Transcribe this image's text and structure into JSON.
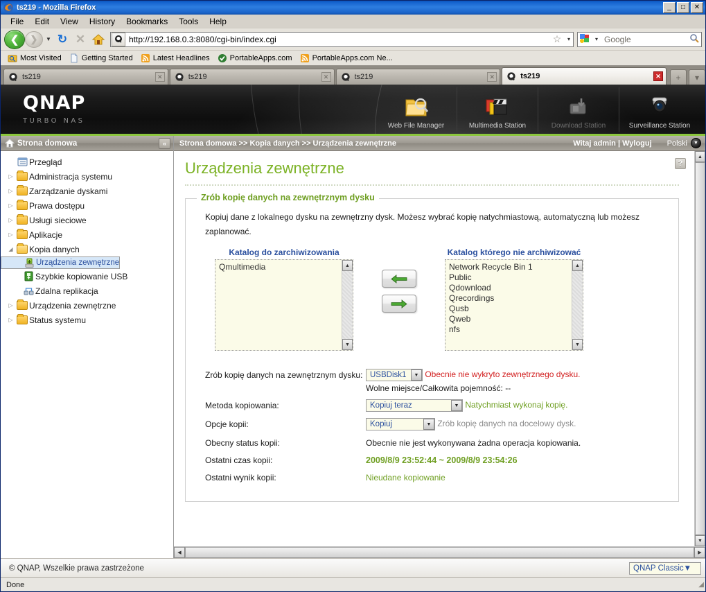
{
  "browser": {
    "title": "ts219 - Mozilla Firefox",
    "window_controls": {
      "minimize": "_",
      "maximize": "□",
      "close": "✕"
    },
    "menu": [
      "File",
      "Edit",
      "View",
      "History",
      "Bookmarks",
      "Tools",
      "Help"
    ],
    "toolbar": {
      "back": "back-button",
      "forward": "forward-button",
      "reload": "↻",
      "stop": "✕",
      "home": "home-button",
      "star": "☆",
      "caret": "▾",
      "magnifier": "search-icon"
    },
    "url": "http://192.168.0.3:8080/cgi-bin/index.cgi",
    "search": {
      "engine": "Google",
      "placeholder": "Google"
    },
    "bookmarks": [
      "Most Visited",
      "Getting Started",
      "Latest Headlines",
      "PortableApps.com",
      "PortableApps.com Ne..."
    ],
    "tabs": [
      {
        "label": "ts219",
        "active": false
      },
      {
        "label": "ts219",
        "active": false
      },
      {
        "label": "ts219",
        "active": false
      },
      {
        "label": "ts219",
        "active": true
      }
    ],
    "newtab_label": "+",
    "tablist_label": "▾",
    "status": "Done"
  },
  "banner": {
    "brand": "QNAP",
    "tagline": "TURBO NAS",
    "apps": [
      {
        "label": "Web File Manager",
        "dim": false
      },
      {
        "label": "Multimedia Station",
        "dim": false
      },
      {
        "label": "Download Station",
        "dim": true
      },
      {
        "label": "Surveillance Station",
        "dim": false
      }
    ]
  },
  "sidebar": {
    "header": "Strona domowa",
    "collapse": "«",
    "items": [
      {
        "label": "Przegląd",
        "kind": "leaf-doc",
        "indent": 0,
        "twisty": "",
        "selected": false
      },
      {
        "label": "Administracja systemu",
        "kind": "folder",
        "indent": 0,
        "twisty": "▷",
        "selected": false
      },
      {
        "label": "Zarządzanie dyskami",
        "kind": "folder",
        "indent": 0,
        "twisty": "▷",
        "selected": false
      },
      {
        "label": "Prawa dostępu",
        "kind": "folder",
        "indent": 0,
        "twisty": "▷",
        "selected": false
      },
      {
        "label": "Usługi sieciowe",
        "kind": "folder",
        "indent": 0,
        "twisty": "▷",
        "selected": false
      },
      {
        "label": "Aplikacje",
        "kind": "folder",
        "indent": 0,
        "twisty": "▷",
        "selected": false
      },
      {
        "label": "Kopia danych",
        "kind": "folder-open",
        "indent": 0,
        "twisty": "◢",
        "selected": false
      },
      {
        "label": "Urządzenia zewnętrzne",
        "kind": "leaf-usbdisk",
        "indent": 1,
        "twisty": "",
        "selected": true
      },
      {
        "label": "Szybkie kopiowanie USB",
        "kind": "leaf-usb",
        "indent": 1,
        "twisty": "",
        "selected": false
      },
      {
        "label": "Zdalna replikacja",
        "kind": "leaf-replicate",
        "indent": 1,
        "twisty": "",
        "selected": false
      },
      {
        "label": "Urządzenia zewnętrzne",
        "kind": "folder",
        "indent": 0,
        "twisty": "▷",
        "selected": false
      },
      {
        "label": "Status systemu",
        "kind": "folder",
        "indent": 0,
        "twisty": "▷",
        "selected": false
      }
    ]
  },
  "crumbbar": {
    "breadcrumb": "Strona domowa >> Kopia danych >> Urządzenia zewnętrzne",
    "welcome": "Witaj admin | Wyloguj",
    "language": "Polski"
  },
  "main": {
    "page_title": "Urządzenia zewnętrzne",
    "help": "?",
    "fieldset_legend": "Zrób kopię danych na zewnętrznym dysku",
    "description": "Kopiuj dane z lokalnego dysku na zewnętrzny dysk. Możesz wybrać kopię natychmiastową, automatyczną lub możesz zaplanować.",
    "lists": {
      "left_title": "Katalog do zarchiwizowania",
      "left_items": [
        "Qmultimedia"
      ],
      "right_title": "Katalog którego nie archiwizować",
      "right_items": [
        "Network Recycle Bin 1",
        "Public",
        "Qdownload",
        "Qrecordings",
        "Qusb",
        "Qweb",
        "nfs"
      ],
      "move_left": "←",
      "move_right": "→"
    },
    "form": {
      "disk_label": "Zrób kopię danych na zewnętrznym dysku:",
      "disk_value": "USBDisk1",
      "disk_note": "Obecnie nie wykryto zewnętrznego dysku.",
      "capacity_note": "Wolne miejsce/Całkowita pojemność: --",
      "method_label": "Metoda kopiowania:",
      "method_value": "Kopiuj teraz",
      "method_note": "Natychmiast wykonaj kopię.",
      "option_label": "Opcje kopii:",
      "option_value": "Kopiuj",
      "option_note": "Zrób kopię danych na docelowy dysk.",
      "status_label": "Obecny status kopii:",
      "status_value": "Obecnie nie jest wykonywana żadna operacja kopiowania.",
      "lasttime_label": "Ostatni czas kopii:",
      "lasttime_value": "2009/8/9 23:52:44 ~ 2009/8/9 23:54:26",
      "lastresult_label": "Ostatni wynik kopii:",
      "lastresult_value": "Nieudane kopiowanie"
    }
  },
  "footer": {
    "copyright": "© QNAP, Wszelkie prawa zastrzeżone",
    "theme": "QNAP Classic"
  },
  "colors": {
    "qnap_green": "#8cc63e",
    "title_green": "#7bb224",
    "legend_green": "#6f9f22",
    "error_red": "#d21f1f",
    "link_blue": "#2a4f9e",
    "title_blue": "#0a4fb0",
    "select_bg": "#fbfbe8",
    "sel_row": "#d6e7f8"
  }
}
